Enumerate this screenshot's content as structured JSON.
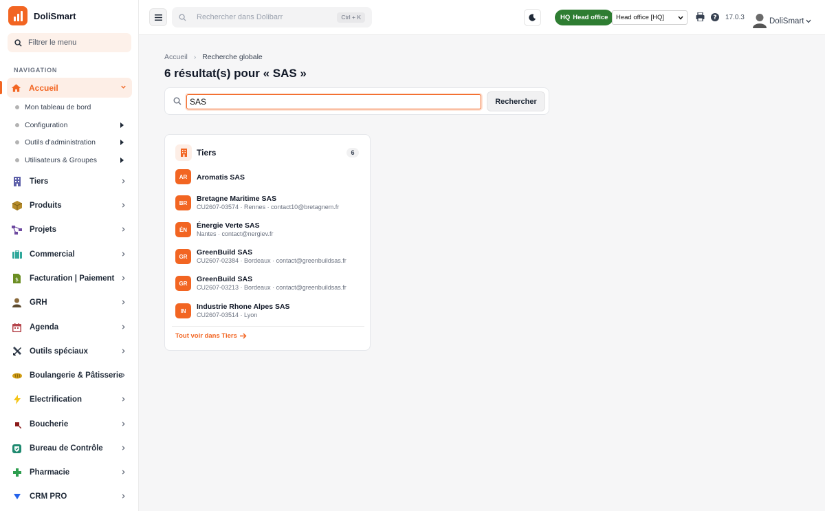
{
  "app": {
    "name": "DoliSmart"
  },
  "sidebar": {
    "filter_placeholder": "Filtrer le menu",
    "nav_heading": "NAVIGATION",
    "active_item": {
      "label": "Accueil",
      "icon": "home-icon"
    },
    "sub_items": [
      {
        "label": "Mon tableau de bord"
      },
      {
        "label": "Configuration"
      },
      {
        "label": "Outils d'administration"
      },
      {
        "label": "Utilisateurs & Groupes"
      }
    ],
    "items": [
      {
        "label": "Tiers",
        "icon": "building-icon"
      },
      {
        "label": "Produits",
        "icon": "box-icon"
      },
      {
        "label": "Projets",
        "icon": "project-icon"
      },
      {
        "label": "Commercial",
        "icon": "briefcase-icon"
      },
      {
        "label": "Facturation | Paiement",
        "icon": "invoice-icon"
      },
      {
        "label": "GRH",
        "icon": "person-icon"
      },
      {
        "label": "Agenda",
        "icon": "calendar-icon"
      },
      {
        "label": "Outils spéciaux",
        "icon": "tools-icon"
      },
      {
        "label": "Boulangerie & Pâtisserie",
        "icon": "bread-icon"
      },
      {
        "label": "Electrification",
        "icon": "lightning-icon"
      },
      {
        "label": "Boucherie",
        "icon": "meat-icon"
      },
      {
        "label": "Bureau de Contrôle",
        "icon": "shield-check-icon"
      },
      {
        "label": "Pharmacie",
        "icon": "pharmacy-cross-icon"
      },
      {
        "label": "CRM PRO",
        "icon": "crm-icon"
      }
    ]
  },
  "topbar": {
    "search_placeholder": "Rechercher dans Dolibarr",
    "search_shortcut": "Ctrl + K",
    "hq_badge_code": "HQ",
    "hq_badge_label": "Head office",
    "entity_selected": "Head office [HQ]",
    "version": "17.0.3",
    "user_name": "DoliSmart"
  },
  "breadcrumb": {
    "home": "Accueil",
    "current": "Recherche globale"
  },
  "page": {
    "title": "6 résultat(s) pour « SAS »",
    "search_value": "SAS",
    "search_button": "Rechercher"
  },
  "results": {
    "section_title": "Tiers",
    "count": "6",
    "items": [
      {
        "initials": "AR",
        "name": "Aromatis SAS",
        "meta": ""
      },
      {
        "initials": "BR",
        "name": "Bretagne Maritime SAS",
        "meta": "CU2607-03574 · Rennes · contact10@bretagnem.fr"
      },
      {
        "initials": "ÉN",
        "name": "Énergie Verte SAS",
        "meta": "Nantes · contact@nergiev.fr"
      },
      {
        "initials": "GR",
        "name": "GreenBuild SAS",
        "meta": "CU2607-02384 · Bordeaux · contact@greenbuildsas.fr"
      },
      {
        "initials": "GR",
        "name": "GreenBuild SAS",
        "meta": "CU2607-03213 · Bordeaux · contact@greenbuildsas.fr"
      },
      {
        "initials": "IN",
        "name": "Industrie Rhone Alpes SAS",
        "meta": "CU2607-03514 · Lyon"
      }
    ],
    "see_all": "Tout voir dans Tiers"
  },
  "colors": {
    "accent": "#f26522",
    "hq_green": "#2e7d32"
  }
}
